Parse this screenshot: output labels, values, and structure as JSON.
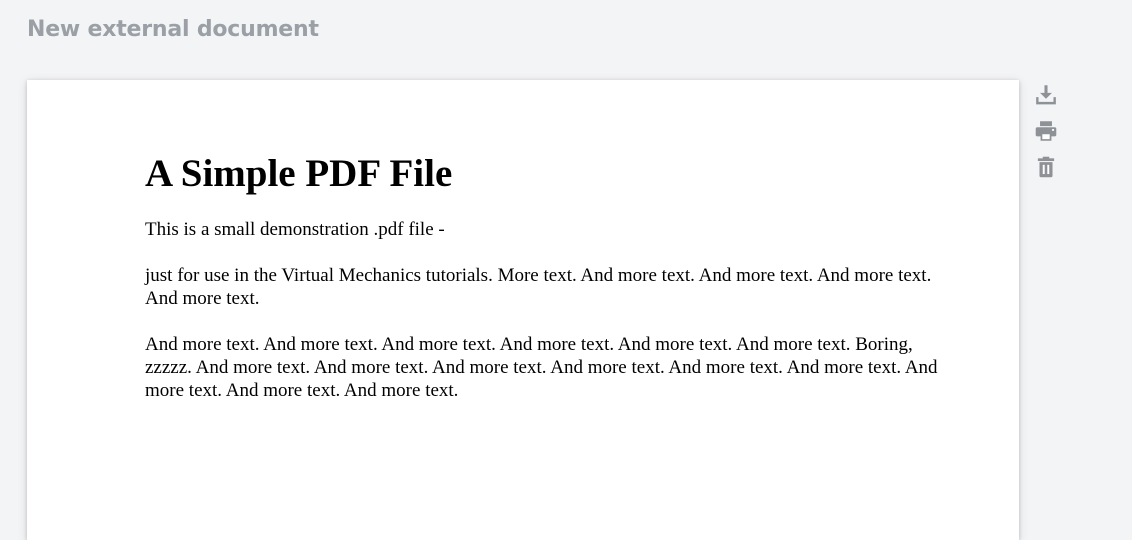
{
  "header": {
    "title": "New external document"
  },
  "document": {
    "heading": "A Simple PDF File",
    "paragraphs": [
      "This is a small demonstration .pdf file -",
      "just for use in the Virtual Mechanics tutorials. More text. And more text. And more text. And more text. And more text.",
      "And more text. And more text. And more text. And more text. And more text. And more text. Boring, zzzzz. And more text. And more text. And more text. And more text. And more text. And more text. And more text. And more text. And more text."
    ]
  },
  "actions": [
    {
      "icon": "download-icon"
    },
    {
      "icon": "print-icon"
    },
    {
      "icon": "trash-icon"
    }
  ],
  "colors": {
    "background": "#f3f4f6",
    "header_text": "#9aa0a6",
    "icon": "#8e9296",
    "document_bg": "#ffffff"
  }
}
